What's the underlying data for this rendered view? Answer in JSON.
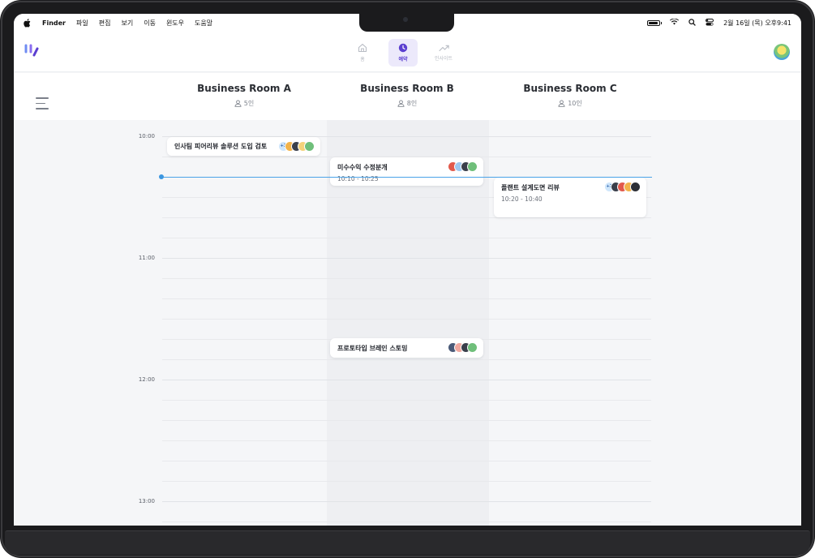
{
  "menubar": {
    "app": "Finder",
    "items": [
      "파일",
      "편집",
      "보기",
      "이동",
      "윈도우",
      "도움말"
    ],
    "datetime": "2월 16일 (목) 오후9:41"
  },
  "nav": {
    "home": "홈",
    "reservation": "예약",
    "insight": "인사이트"
  },
  "rooms": [
    {
      "name": "Business Room A",
      "capacity": "5인"
    },
    {
      "name": "Business Room B",
      "capacity": "8인"
    },
    {
      "name": "Business Room C",
      "capacity": "10인"
    }
  ],
  "times": [
    "10:00",
    "11:00",
    "12:00",
    "13:00"
  ],
  "events": [
    {
      "title": "인사팀 피어리뷰 솔루션 도입 검토",
      "time": "",
      "more": "+2"
    },
    {
      "title": "미수수익 수정분개",
      "time": "10:10 - 10:25",
      "more": ""
    },
    {
      "title": "플랜트 설계도면 리뷰",
      "time": "10:20 - 10:40",
      "more": "+2"
    },
    {
      "title": "프로토타입 브레인 스토밍",
      "time": "",
      "more": ""
    }
  ],
  "colors": {
    "accent": "#5b3fd0",
    "now_indicator": "#3b96e0"
  }
}
